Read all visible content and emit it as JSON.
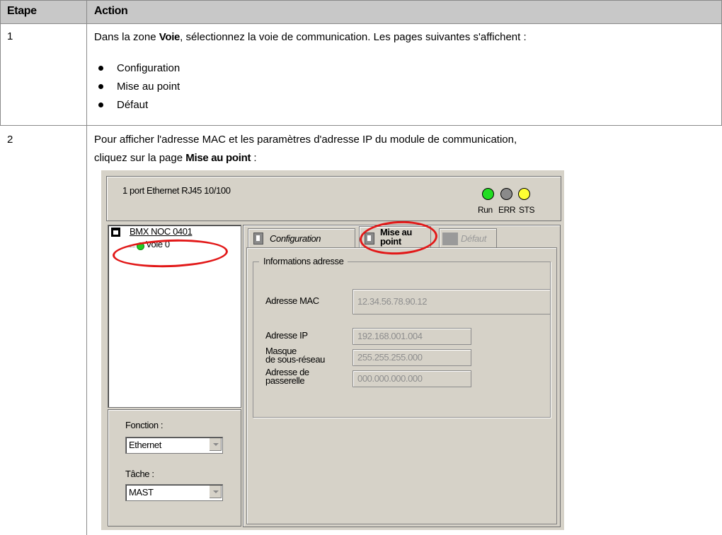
{
  "table": {
    "header": {
      "step": "Etape",
      "action": "Action"
    },
    "row1": {
      "step": "1",
      "text_before": "Dans la zone ",
      "text_bold": "Voie",
      "text_after": ", sélectionnez la voie de communication. Les pages suivantes s'affichent :",
      "bullets": [
        "Configuration",
        "Mise au point",
        "Défaut"
      ]
    },
    "row2": {
      "step": "2",
      "line1": "Pour afficher l'adresse MAC et les paramètres d'adresse IP du module de communication,",
      "line2_before": "cliquez sur la page ",
      "line2_bold": "Mise au point",
      "line2_after": " :"
    }
  },
  "screenshot": {
    "module_title": "1 port Ethernet RJ45 10/100",
    "leds": [
      {
        "label": "Run",
        "color": "#22dd22"
      },
      {
        "label": "ERR",
        "color": "#8a8a8a"
      },
      {
        "label": "STS",
        "color": "#ffff33"
      }
    ],
    "tree": {
      "module": "BMX NOC 0401",
      "channel": "Voie 0"
    },
    "function_label": "Fonction :",
    "function_value": "Ethernet",
    "task_label": "Tâche :",
    "task_value": "MAST",
    "tabs": {
      "configuration": "Configuration",
      "mise_line1": "Mise au",
      "mise_line2": "point",
      "defaut": "Défaut"
    },
    "group_title": "Informations adresse",
    "fields": {
      "mac_label": "Adresse MAC",
      "mac_value": "12.34.56.78.90.12",
      "ip_label": "Adresse IP",
      "ip_value": "192.168.001.004",
      "mask_label_1": "Masque",
      "mask_label_2": "de sous-réseau",
      "mask_value": "255.255.255.000",
      "gw_label_1": "Adresse de",
      "gw_label_2": "passerelle",
      "gw_value": "000.000.000.000"
    },
    "highlight_color": "#e21818"
  }
}
